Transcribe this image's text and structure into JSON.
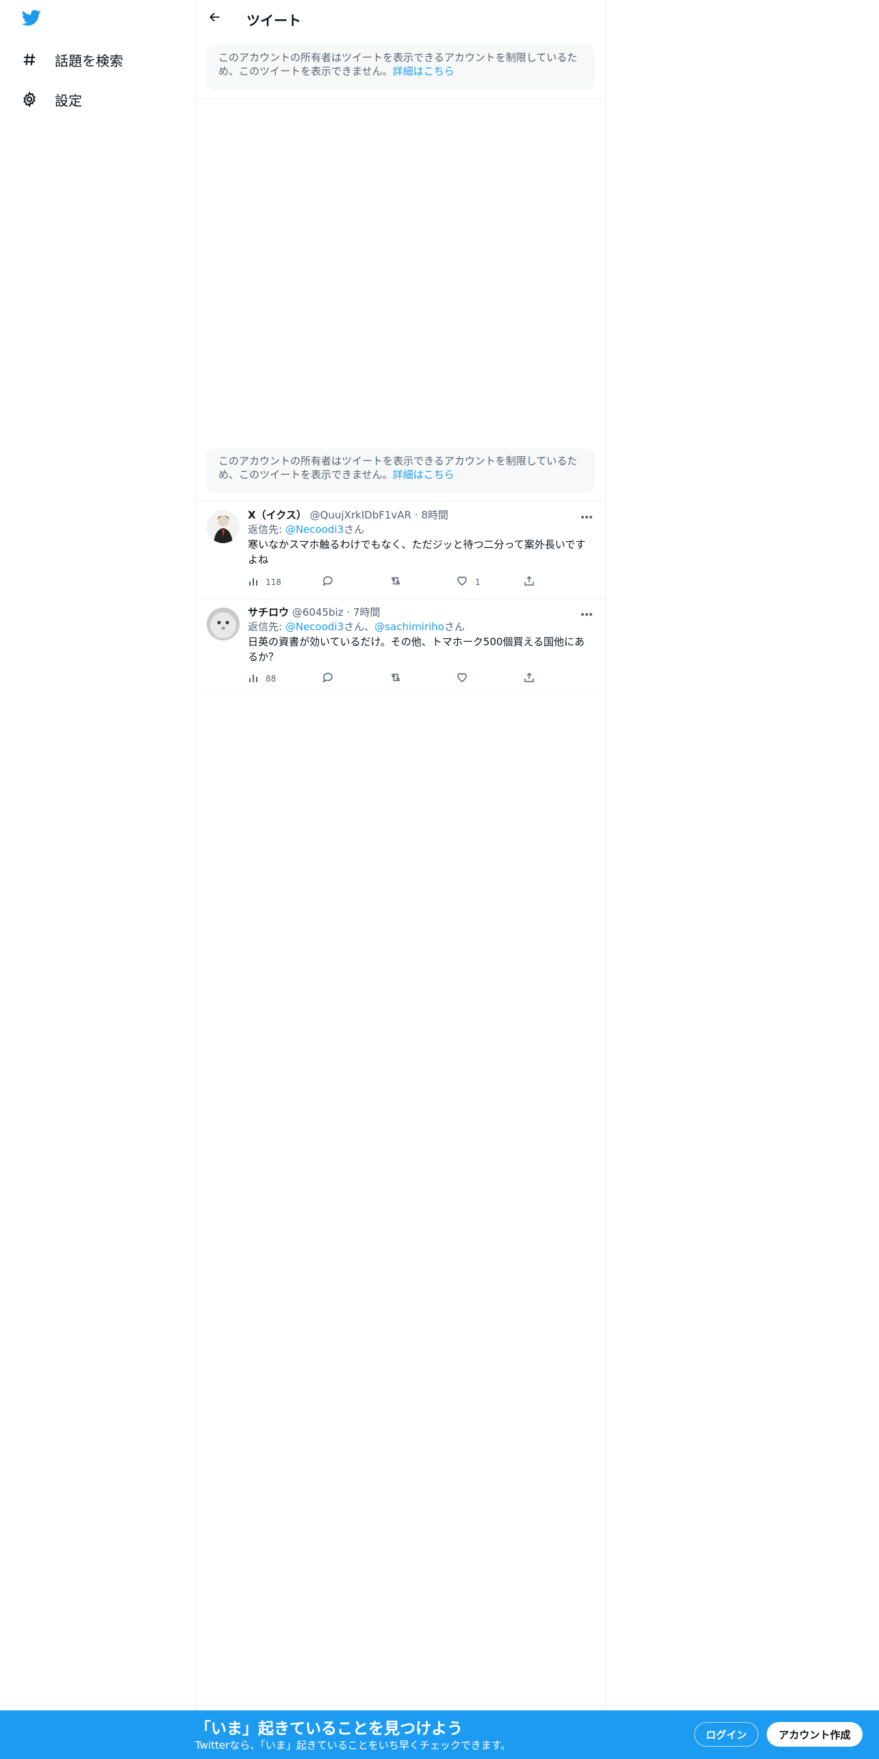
{
  "sidebar": {
    "logo_icon": "twitter-bird-icon",
    "items": [
      {
        "label": "話題を検索",
        "icon": "hashtag-icon"
      },
      {
        "label": "設定",
        "icon": "gear-icon"
      }
    ]
  },
  "header": {
    "title": "ツイート",
    "back_icon": "arrow-left-icon"
  },
  "notices": [
    {
      "text": "このアカウントの所有者はツイートを表示できるアカウントを制限しているため、このツイートを表示できません。",
      "link": "詳細はこちら"
    },
    {
      "text": "このアカウントの所有者はツイートを表示できるアカウントを制限しているため、このツイートを表示できません。",
      "link": "詳細はこちら"
    }
  ],
  "tweets": [
    {
      "name": "X（イクス）",
      "handle": "@QuujXrkIDbF1vAR",
      "sep": "·",
      "time": "8時間",
      "reply_prefix": "返信先: ",
      "mentions": [
        "@Necoodi3"
      ],
      "mention_suffix": "さん",
      "mention_joiner": "さん、",
      "text": "寒いなかスマホ触るわけでもなく、ただジッと待つ二分って案外長いですよね",
      "views": "118",
      "replies": "",
      "retweets": "",
      "likes": "1"
    },
    {
      "name": "サチロウ",
      "handle": "@6045biz",
      "sep": "·",
      "time": "7時間",
      "reply_prefix": "返信先: ",
      "mentions": [
        "@Necoodi3",
        "@sachimiriho"
      ],
      "mention_suffix": "さん",
      "mention_joiner": "さん、",
      "text": "日英の資書が効いているだけ。その他、トマホーク500個買える国他にあるか？",
      "views": "88",
      "replies": "",
      "retweets": "",
      "likes": ""
    }
  ],
  "banner": {
    "title": "「いま」起きていることを見つけよう",
    "subtitle": "Twitterなら、「いま」起きていることをいち早くチェックできます。",
    "login": "ログイン",
    "signup": "アカウント作成"
  },
  "colors": {
    "accent": "#1d9bf0",
    "text": "#0f1419",
    "muted": "#536471",
    "notice_bg": "#f7f9f9"
  }
}
